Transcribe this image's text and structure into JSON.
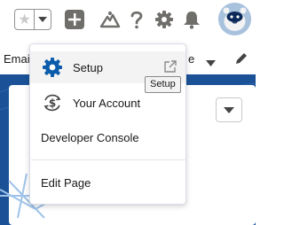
{
  "header": {
    "favorites_star_icon": "star-icon",
    "favorites_menu_icon": "chevron-down-icon",
    "add_icon": "plus-icon",
    "trailhead_icon": "trailhead-icon",
    "help_icon": "question-icon",
    "setup_icon": "gear-icon",
    "notifications_icon": "bell-icon",
    "avatar_icon": "astro-avatar-icon"
  },
  "page": {
    "nav_partial_left": "Emai",
    "nav_partial_right": "e",
    "band_color": "#1b5297"
  },
  "menu": {
    "items": [
      {
        "label": "Setup",
        "icon": "gear-icon",
        "external_icon": "external-link-icon"
      },
      {
        "label": "Your Account",
        "icon": "account-icon"
      },
      {
        "label": "Developer Console"
      },
      {
        "label": "Edit Page"
      }
    ],
    "tooltip": "Setup",
    "accent_color": "#0b5cab"
  }
}
